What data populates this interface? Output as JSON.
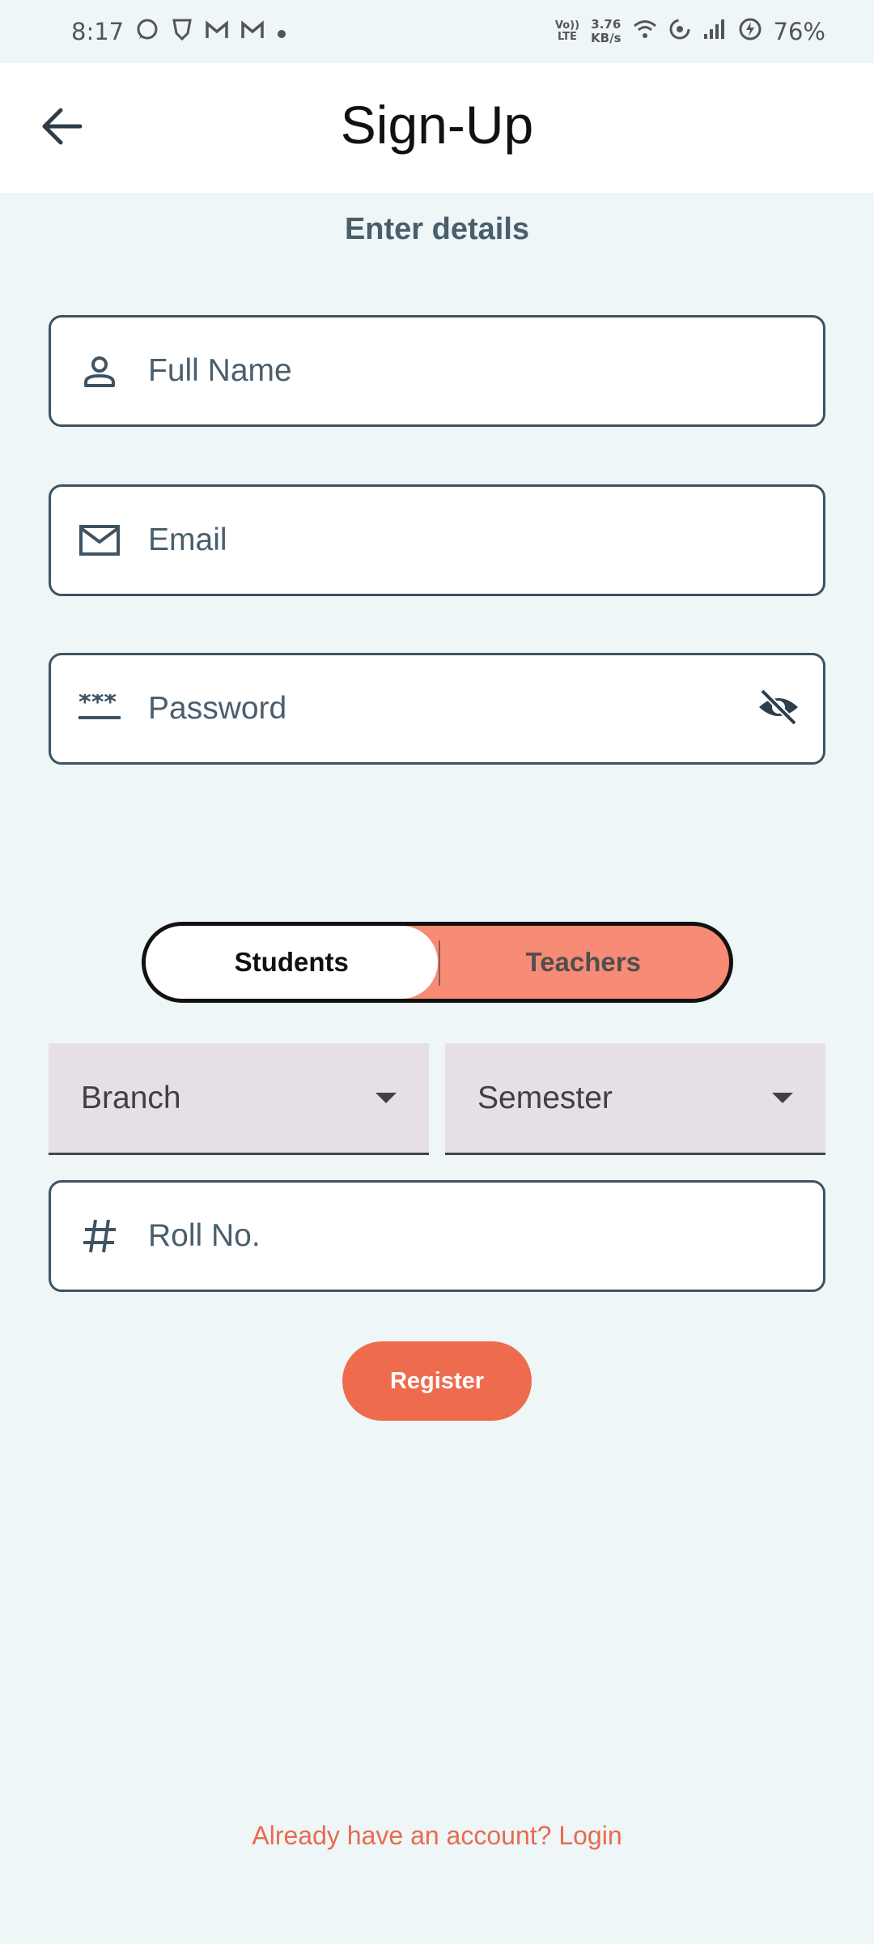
{
  "status_bar": {
    "time": "8:17",
    "net_rate_value": "3.76",
    "net_rate_unit": "KB/s",
    "volte_top": "Vo))",
    "volte_bottom": "LTE",
    "battery": "76%"
  },
  "app_bar": {
    "title": "Sign-Up",
    "back_icon": "arrow-left-icon"
  },
  "form": {
    "subtitle": "Enter details",
    "full_name_placeholder": "Full Name",
    "email_placeholder": "Email",
    "password_placeholder": "Password",
    "role_toggle": {
      "options": [
        "Students",
        "Teachers"
      ],
      "selected": "Students"
    },
    "branch_label": "Branch",
    "semester_label": "Semester",
    "roll_placeholder": "Roll No.",
    "register_label": "Register",
    "login_link": "Already have an account? Login"
  },
  "colors": {
    "background": "#EEF6F7",
    "accent": "#EF6B4E",
    "toggle_inactive": "#F88B75",
    "field_border": "#3E5363",
    "dropdown_bg": "#E6E0E6"
  }
}
